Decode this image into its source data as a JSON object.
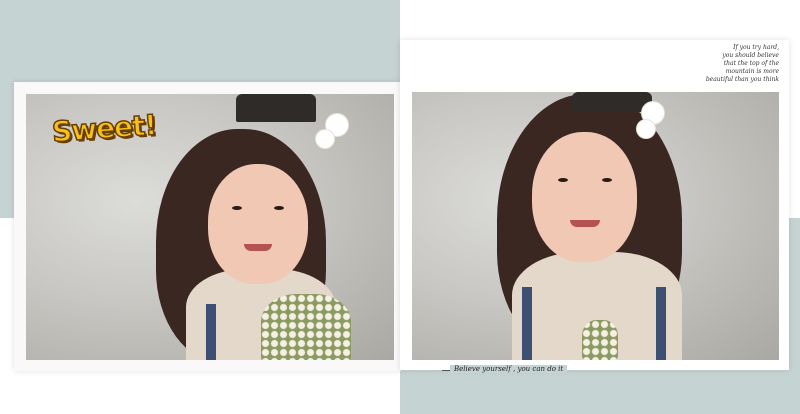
{
  "left_card": {
    "sticker": "Sweet!"
  },
  "right_card": {
    "quote_lines": [
      "If you try hard,",
      "you should believe",
      "that the top of the",
      "mountain is more",
      "beautiful than you think"
    ],
    "caption": "Believe yourself , you can do it"
  },
  "colors": {
    "background_accent": "#c5d3d2",
    "sticker": "#f6c11b"
  }
}
